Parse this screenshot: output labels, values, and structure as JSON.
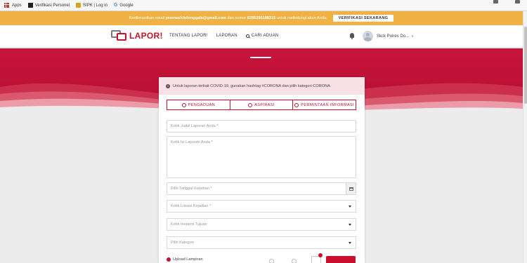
{
  "bookmarks": {
    "items": [
      {
        "label": "Apps",
        "icon": "apps-grid-icon"
      },
      {
        "label": "Verifikasi Personel",
        "icon": "bookmark-favicon"
      },
      {
        "label": "SIPK | Log in",
        "icon": "bookmark-favicon"
      },
      {
        "label": "Google",
        "icon": "google-icon"
      }
    ]
  },
  "notification": {
    "prefix": "Konfirmasikan email",
    "email": "yeemaslckdonggala@gmail.com",
    "middle": "dan nomor",
    "phone": "6285395188315",
    "suffix": "untuk melindungi akun Anda.",
    "button": "VERIFIKASI SEKARANG"
  },
  "header": {
    "logo_text": "LAPOR!",
    "nav": {
      "about": "TENTANG LAPOR!",
      "reports": "LAPORAN",
      "search": "CARI ADUAN"
    },
    "user_name": "Skck Polres Do...",
    "caret": "▼"
  },
  "form": {
    "info_icon": "i",
    "info_text": "Untuk laporan terkait COVID-19, gunakan hashtag #CORONA dan pilih kategori CORONA",
    "tabs": [
      "PENGADUAN",
      "ASPIRASI",
      "PERMINTAAN INFORMASI"
    ],
    "title_placeholder": "Ketik Judul Laporan Anda *",
    "body_placeholder": "Ketik Isi Laporan Anda *",
    "date_placeholder": "Pilih Tanggal Kejadian *",
    "location_placeholder": "Ketik Lokasi Kejadian *",
    "agency_placeholder": "Ketik Instansi Tujuan",
    "category_placeholder": "Pilih Kategori",
    "upload_label": "Upload Lampiran"
  },
  "colors": {
    "accent": "#c8102e",
    "notification_bg": "#f0b245",
    "info_bg": "#f8e1e4"
  }
}
